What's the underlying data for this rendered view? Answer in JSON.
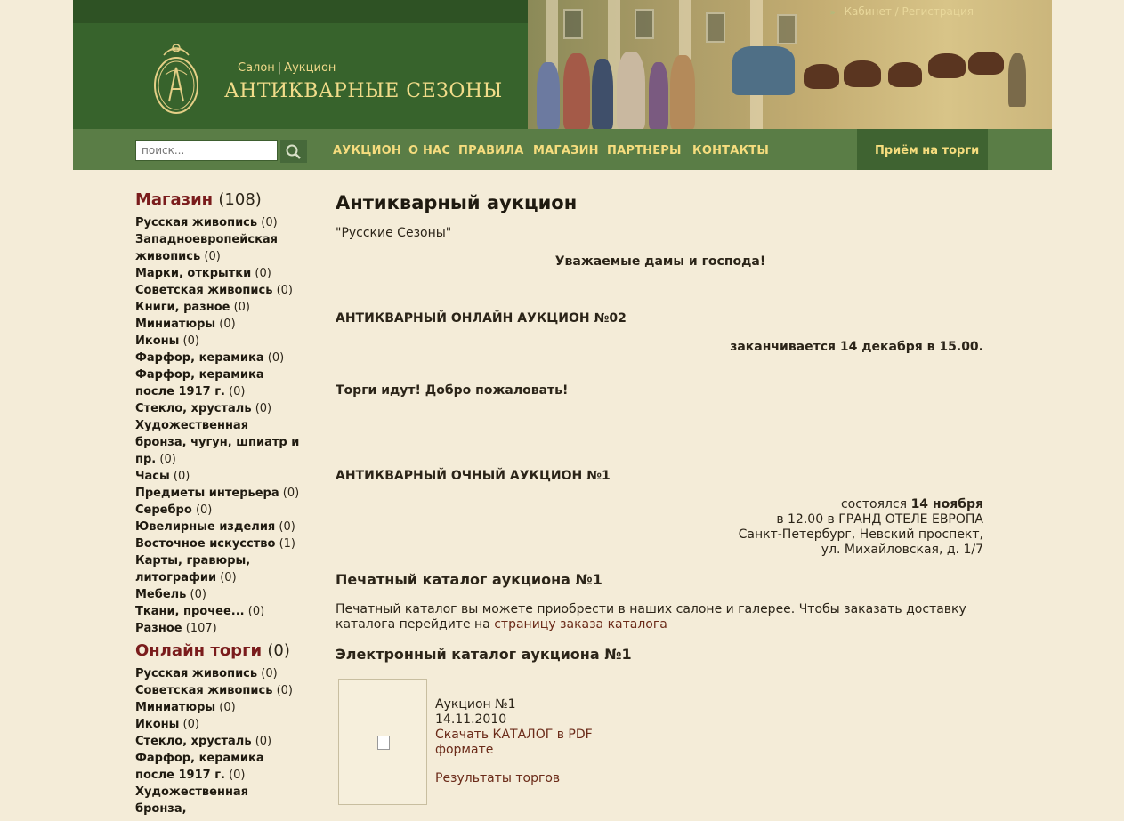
{
  "header": {
    "account_link": "Кабинет",
    "account_sep": "/",
    "register_link": "Регистрация",
    "tagline_salon": "Салон",
    "tagline_sep": "|",
    "tagline_auction": "Аукцион",
    "site_name": "АНТИКВАРНЫЕ СЕЗОНЫ"
  },
  "nav": {
    "search_placeholder": "поиск...",
    "items": [
      "АУКЦИОН",
      "О НАС",
      "ПРАВИЛА",
      "МАГАЗИН",
      "ПАРТНЕРЫ",
      "КОНТАКТЫ"
    ],
    "accept_button": "Приём на торги"
  },
  "sidebar": {
    "shop": {
      "title": "Магазин",
      "count": "(108)",
      "items": [
        {
          "label": "Русская живопись",
          "count": "(0)"
        },
        {
          "label": "Западноевропейская живопись",
          "count": "(0)"
        },
        {
          "label": "Марки, открытки",
          "count": "(0)"
        },
        {
          "label": "Советская живопись",
          "count": "(0)"
        },
        {
          "label": "Книги, разное",
          "count": "(0)"
        },
        {
          "label": "Миниатюры",
          "count": "(0)"
        },
        {
          "label": "Иконы",
          "count": "(0)"
        },
        {
          "label": "Фарфор, керамика",
          "count": "(0)"
        },
        {
          "label": "Фарфор, керамика после 1917 г.",
          "count": "(0)"
        },
        {
          "label": "Стекло, хрусталь",
          "count": "(0)"
        },
        {
          "label": "Художественная бронза, чугун, шпиатр и пр.",
          "count": "(0)"
        },
        {
          "label": "Часы",
          "count": "(0)"
        },
        {
          "label": "Предметы интерьера",
          "count": "(0)"
        },
        {
          "label": "Серебро",
          "count": "(0)"
        },
        {
          "label": "Ювелирные изделия",
          "count": "(0)"
        },
        {
          "label": "Восточное искусство",
          "count": "(1)"
        },
        {
          "label": "Карты, гравюры, литографии",
          "count": "(0)"
        },
        {
          "label": "Мебель",
          "count": "(0)"
        },
        {
          "label": "Ткани, прочее...",
          "count": "(0)"
        },
        {
          "label": "Разное",
          "count": "(107)"
        }
      ]
    },
    "online": {
      "title": "Онлайн торги",
      "count": "(0)",
      "items": [
        {
          "label": "Русская живопись",
          "count": "(0)"
        },
        {
          "label": "Советская живопись",
          "count": "(0)"
        },
        {
          "label": "Миниатюры",
          "count": "(0)"
        },
        {
          "label": "Иконы",
          "count": "(0)"
        },
        {
          "label": "Стекло, хрусталь",
          "count": "(0)"
        },
        {
          "label": "Фарфор, керамика после 1917 г.",
          "count": "(0)"
        },
        {
          "label": "Художественная бронза,",
          "count": ""
        }
      ]
    }
  },
  "main": {
    "title": "Антикварный аукцион",
    "subtitle": "\"Русские Сезоны\"",
    "greeting": "Уважаемые дамы и господа!",
    "online_auction_title": "АНТИКВАРНЫЙ ОНЛАЙН АУКЦИОН №02",
    "online_auction_end": "заканчивается 14 декабря в 15.00.",
    "welcome": "Торги идут! Добро пожаловать!",
    "offline_auction_title": "АНТИКВАРНЫЙ ОЧНЫЙ АУКЦИОН №1",
    "offline_held_prefix": "состоялся",
    "offline_held_date": "14 ноября",
    "offline_time_place": "в 12.00 в ГРАНД ОТЕЛЕ ЕВРОПА",
    "offline_address_1": "Санкт-Петербург, Невский проспект,",
    "offline_address_2": "ул. Михайловская, д. 1/7",
    "print_catalog_title": "Печатный каталог аукциона №1",
    "print_catalog_text": "Печатный каталог вы можете приобрести в наших салоне и галерее. Чтобы заказать доставку каталога перейдите на",
    "print_catalog_link": "страницу заказа каталога",
    "e_catalog_title": "Электронный каталог аукциона №1",
    "e_catalog_name": "Аукцион №1",
    "e_catalog_date": "14.11.2010",
    "e_catalog_download": "Скачать КАТАЛОГ в PDF формате",
    "e_catalog_results": "Результаты торгов"
  },
  "colors": {
    "header_green": "#37632c",
    "nav_green": "#5a7d46",
    "nav_text": "#f6dd7e",
    "background": "#f4ecd8",
    "sidebar_heading": "#7a1c1c",
    "link": "#6a2a18"
  }
}
